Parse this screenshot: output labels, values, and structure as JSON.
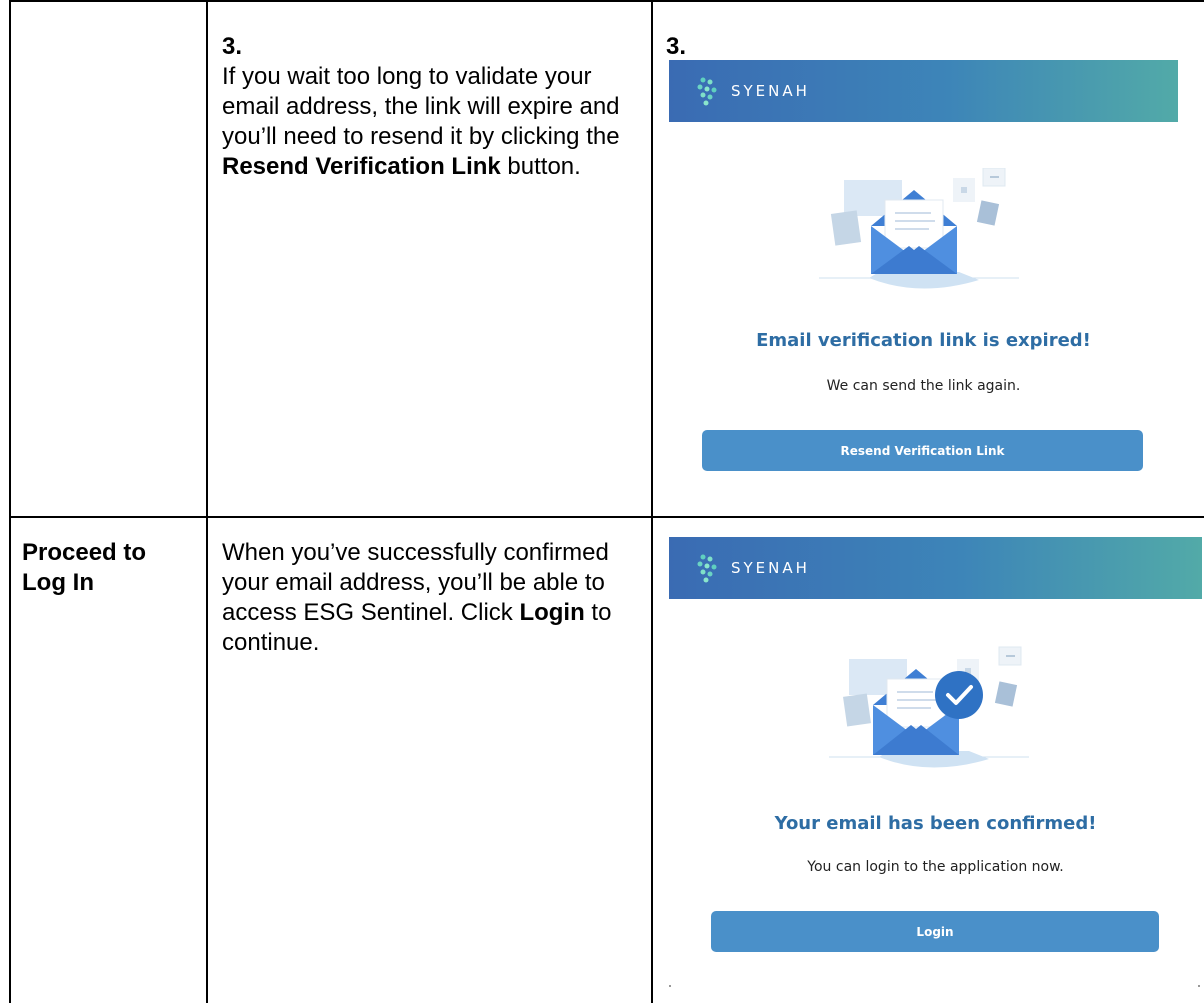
{
  "row1": {
    "step_left": "3.",
    "instruction_part1": "If you wait too long to validate your email address, the link will expire and you’ll need to resend it by clicking the ",
    "instruction_bold": "Resend Verification Link",
    "instruction_part2": " button.",
    "step_right": "3.",
    "screenshot": {
      "brand": "SYENAH",
      "heading": "Email verification link is expired!",
      "message": "We can send the link again.",
      "button_label": "Resend Verification Link"
    }
  },
  "row2": {
    "label": "Proceed to Log In",
    "instruction_part1": "When you’ve successfully confirmed your email address, you’ll be able to access ESG Sentinel. Click ",
    "instruction_bold": "Login",
    "instruction_part2": " to continue.",
    "screenshot": {
      "brand": "SYENAH",
      "heading": "Your email has been confirmed!",
      "message": "You can login to the application now.",
      "button_label": "Login"
    }
  },
  "colors": {
    "accent": "#2e6da4",
    "button": "#4a90c9",
    "banner_start": "#3a6bb3",
    "banner_end": "#52aaa8",
    "envelope": "#4f8fe0"
  }
}
